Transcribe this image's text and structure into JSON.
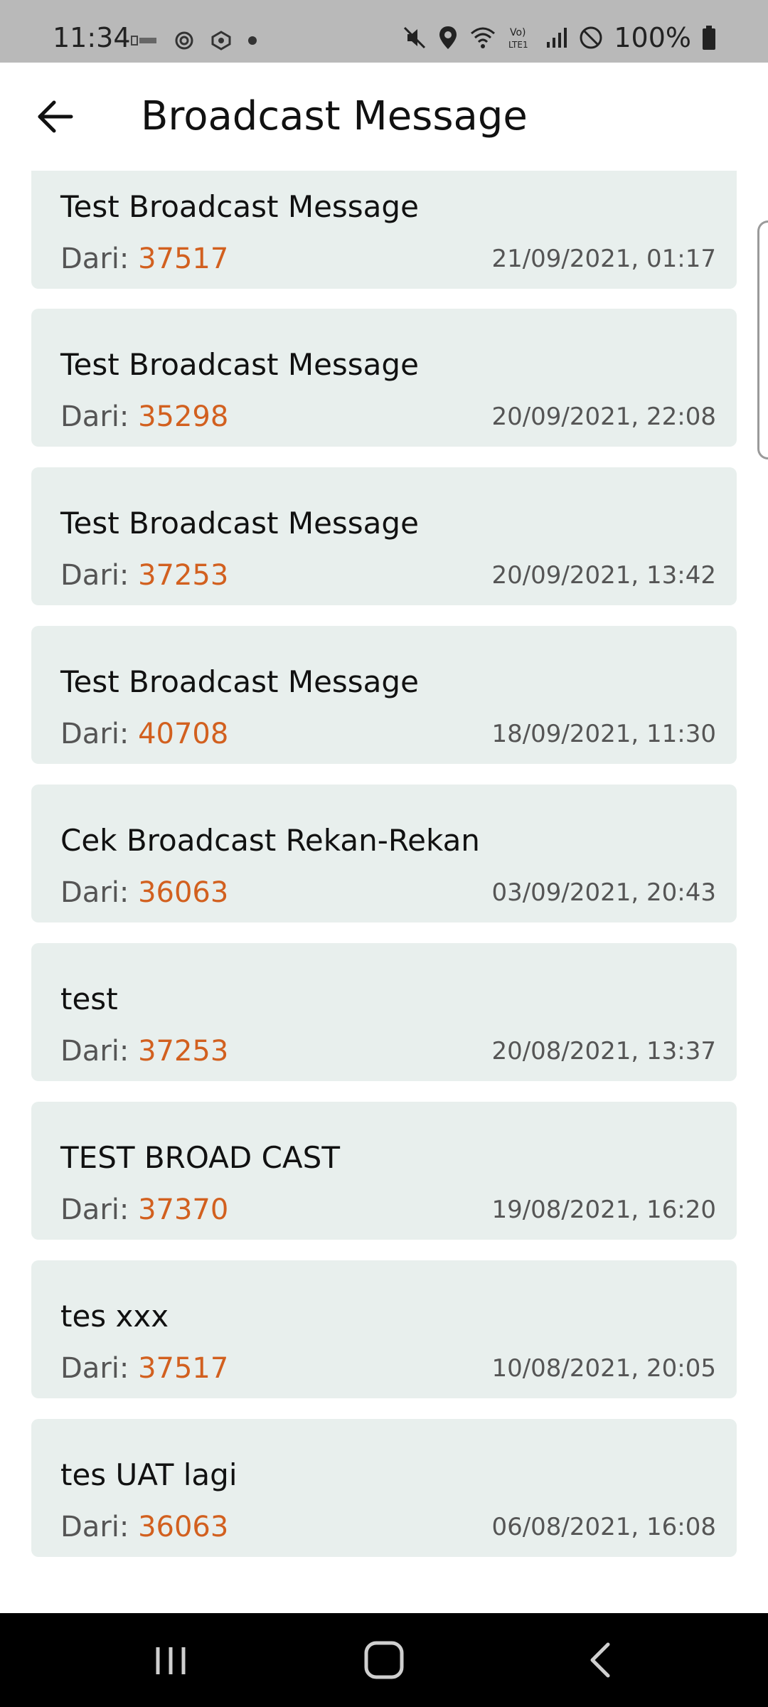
{
  "status_bar": {
    "time": "11:34",
    "battery": "100%",
    "icons_left": [
      "bni-icon",
      "settings-icon",
      "app-icon",
      "dot-icon"
    ],
    "icons_right": [
      "mute-icon",
      "location-icon",
      "wifi-icon",
      "volte-icon",
      "signal-icon",
      "block-icon",
      "battery-icon"
    ]
  },
  "header": {
    "title": "Broadcast Message",
    "back_icon": "arrow-left-icon"
  },
  "messages": [
    {
      "title": "Test Broadcast Message",
      "from_label": "Dari: ",
      "sender": "37517",
      "datetime": "21/09/2021, 01:17"
    },
    {
      "title": "Test Broadcast Message",
      "from_label": "Dari: ",
      "sender": "35298",
      "datetime": "20/09/2021, 22:08"
    },
    {
      "title": "Test Broadcast Message",
      "from_label": "Dari: ",
      "sender": "37253",
      "datetime": "20/09/2021, 13:42"
    },
    {
      "title": "Test Broadcast Message",
      "from_label": "Dari: ",
      "sender": "40708",
      "datetime": "18/09/2021, 11:30"
    },
    {
      "title": "Cek Broadcast Rekan-Rekan",
      "from_label": "Dari: ",
      "sender": "36063",
      "datetime": "03/09/2021, 20:43"
    },
    {
      "title": "test",
      "from_label": "Dari: ",
      "sender": "37253",
      "datetime": "20/08/2021, 13:37"
    },
    {
      "title": "TEST BROAD CAST",
      "from_label": "Dari: ",
      "sender": "37370",
      "datetime": "19/08/2021, 16:20"
    },
    {
      "title": "tes xxx",
      "from_label": "Dari: ",
      "sender": "37517",
      "datetime": "10/08/2021, 20:05"
    },
    {
      "title": "tes UAT lagi",
      "from_label": "Dari: ",
      "sender": "36063",
      "datetime": "06/08/2021, 16:08"
    }
  ],
  "colors": {
    "accent": "#d2601f",
    "card_background": "#e8efed",
    "status_bar": "#b9b9b9",
    "nav_bar": "#000000"
  },
  "nav_bar": {
    "icons": [
      "recent-apps-icon",
      "home-icon",
      "back-icon"
    ]
  }
}
